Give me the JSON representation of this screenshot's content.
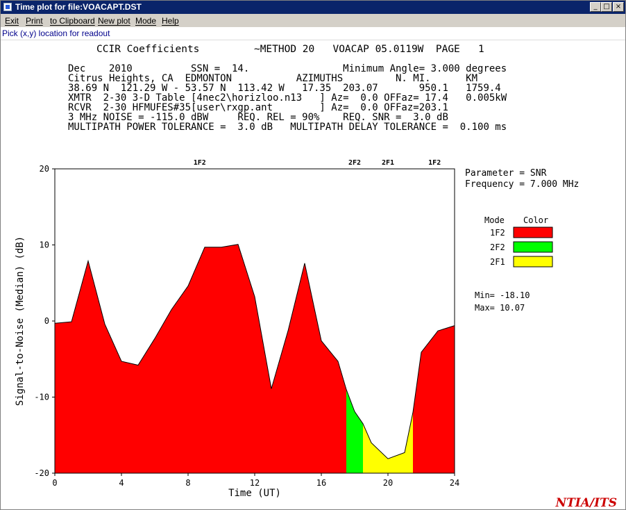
{
  "window": {
    "title": "Time plot for file:VOACAPT.DST",
    "minimize_glyph": "_",
    "maximize_glyph": "□",
    "close_glyph": "×"
  },
  "menu": {
    "exit": "Exit",
    "print": "Print",
    "clipboard": "to Clipboard",
    "newplot": "New plot",
    "mode": "Mode",
    "help": "Help"
  },
  "status": "Pick (x,y) location for readout",
  "report": {
    "line1": "CCIR Coefficients         ~METHOD 20   VOACAP 05.0119W  PAGE   1",
    "lines": [
      "Dec    2010          SSN =  14.                Minimum Angle= 3.000 degrees",
      "Citrus Heights, CA  EDMONTON           AZIMUTHS         N. MI.      KM",
      "38.69 N  121.29 W - 53.57 N  113.42 W   17.35  203.07       950.1   1759.4",
      "XMTR  2-30 3-D Table [4nec2\\horizloo.n13   ] Az=  0.0 OFFaz= 17.4   0.005kW",
      "RCVR  2-30 HFMUFES#35[user\\rxgp.ant        ] Az=  0.0 OFFaz=203.1",
      "3 MHz NOISE = -115.0 dBW     REQ. REL = 90%    REQ. SNR =  3.0 dB",
      "MULTIPATH POWER TOLERANCE =  3.0 dB   MULTIPATH DELAY TOLERANCE =  0.100 ms"
    ]
  },
  "params": {
    "parameter": "Parameter = SNR",
    "frequency": "Frequency =  7.000 MHz"
  },
  "legend": {
    "header_mode": "Mode",
    "header_color": "Color",
    "items": [
      {
        "mode": "1F2",
        "color": "#ff0000"
      },
      {
        "mode": "2F2",
        "color": "#00ff00"
      },
      {
        "mode": "2F1",
        "color": "#ffff00"
      }
    ]
  },
  "stats": {
    "min": "Min= -18.10",
    "max": "Max=  10.07"
  },
  "logo": "NTIA/ITS",
  "chart_data": {
    "type": "area",
    "xlabel": "Time  (UT)",
    "ylabel": "Signal-to-Noise  (Median)  (dB)",
    "xlim": [
      0,
      24
    ],
    "ylim": [
      -20,
      20
    ],
    "xticks": [
      0,
      4,
      8,
      12,
      16,
      20,
      24
    ],
    "yticks": [
      -20,
      -10,
      0,
      10,
      20
    ],
    "x": [
      0,
      1,
      2,
      3,
      4,
      5,
      6,
      7,
      8,
      9,
      10,
      11,
      12,
      13,
      14,
      15,
      16,
      17,
      17.5,
      18,
      18.5,
      19,
      20,
      21,
      21.5,
      22,
      23,
      24
    ],
    "y": [
      -0.3,
      -0.1,
      7.9,
      -0.4,
      -5.3,
      -5.8,
      -2.3,
      1.5,
      4.6,
      9.7,
      9.7,
      10.07,
      3.2,
      -8.9,
      -1.3,
      7.6,
      -2.6,
      -5.3,
      -9.0,
      -11.9,
      -13.5,
      -16.0,
      -18.1,
      -17.3,
      -12.0,
      -4.1,
      -1.3,
      -0.6
    ],
    "series_segments": [
      {
        "mode": "1F2",
        "from": 0,
        "to": 17.5,
        "color": "#ff0000"
      },
      {
        "mode": "2F2",
        "from": 17.5,
        "to": 18.5,
        "color": "#00ff00"
      },
      {
        "mode": "2F1",
        "from": 18.5,
        "to": 21.5,
        "color": "#ffff00"
      },
      {
        "mode": "1F2",
        "from": 21.5,
        "to": 24,
        "color": "#ff0000"
      }
    ],
    "top_labels": [
      {
        "x": 8.7,
        "label": "1F2"
      },
      {
        "x": 18.0,
        "label": "2F2"
      },
      {
        "x": 20.0,
        "label": "2F1"
      },
      {
        "x": 22.8,
        "label": "1F2"
      }
    ]
  }
}
